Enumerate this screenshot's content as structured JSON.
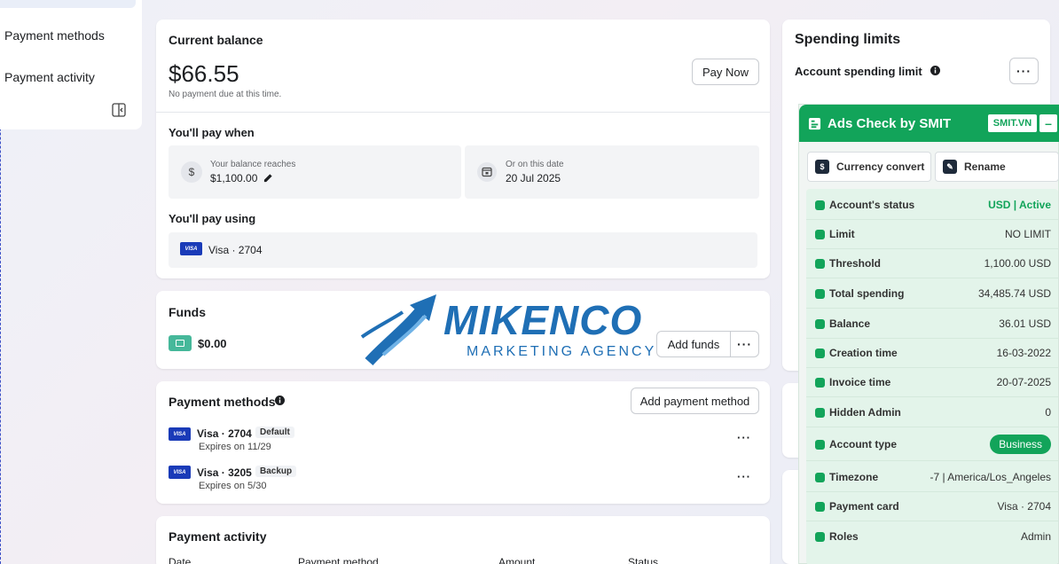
{
  "sidebar": {
    "items": [
      {
        "label": "Payment methods"
      },
      {
        "label": "Payment activity"
      }
    ]
  },
  "balance_card": {
    "title": "Current balance",
    "amount": "$66.55",
    "note": "No payment due at this time.",
    "pay_now": "Pay Now",
    "pay_when_title": "You'll pay when",
    "threshold_label": "Your balance reaches",
    "threshold_value": "$1,100.00",
    "date_label": "Or on this date",
    "date_value": "20 Jul 2025",
    "pay_using_title": "You'll pay using",
    "card_label": "Visa · 2704"
  },
  "funds_card": {
    "title": "Funds",
    "amount": "$0.00",
    "add_funds": "Add funds"
  },
  "payment_methods_card": {
    "title": "Payment methods",
    "add_button": "Add payment method",
    "methods": [
      {
        "name": "Visa · 2704",
        "tag": "Default",
        "expiry": "Expires on 11/29"
      },
      {
        "name": "Visa · 3205",
        "tag": "Backup",
        "expiry": "Expires on 5/30"
      }
    ]
  },
  "payment_activity_card": {
    "title": "Payment activity",
    "columns": [
      "Date",
      "Payment method",
      "Amount",
      "Status"
    ]
  },
  "spending_card": {
    "title": "Spending limits",
    "subtitle": "Account spending limit"
  },
  "visa_text": "VISA",
  "logo": {
    "name": "MIKENCO",
    "tagline": "MARKETING AGENCY"
  },
  "extension": {
    "title": "Ads Check by SMIT",
    "badge": "SMIT.VN",
    "minimize": "–",
    "currency_convert": "Currency convert",
    "rename": "Rename",
    "rows": [
      {
        "label": "Account's status",
        "value": "USD | Active",
        "style": "green"
      },
      {
        "label": "Limit",
        "value": "NO LIMIT",
        "style": "plain"
      },
      {
        "label": "Threshold",
        "value": "1,100.00 USD",
        "style": "plain"
      },
      {
        "label": "Total spending",
        "value": "34,485.74 USD",
        "style": "plain"
      },
      {
        "label": "Balance",
        "value": "36.01 USD",
        "style": "plain"
      },
      {
        "label": "Creation time",
        "value": "16-03-2022",
        "style": "plain"
      },
      {
        "label": "Invoice time",
        "value": "20-07-2025",
        "style": "plain"
      },
      {
        "label": "Hidden Admin",
        "value": "0",
        "style": "plain"
      },
      {
        "label": "Account type",
        "value": "Business",
        "style": "pill"
      },
      {
        "label": "Timezone",
        "value": "-7 | America/Los_Angeles",
        "style": "plain"
      },
      {
        "label": "Payment card",
        "value": "Visa · 2704",
        "style": "plain"
      },
      {
        "label": "Roles",
        "value": "Admin",
        "style": "plain"
      }
    ]
  },
  "colors": {
    "accent_green": "#12a45a",
    "visa_blue": "#1a3bb8",
    "logo_blue": "#1f6fb5"
  }
}
